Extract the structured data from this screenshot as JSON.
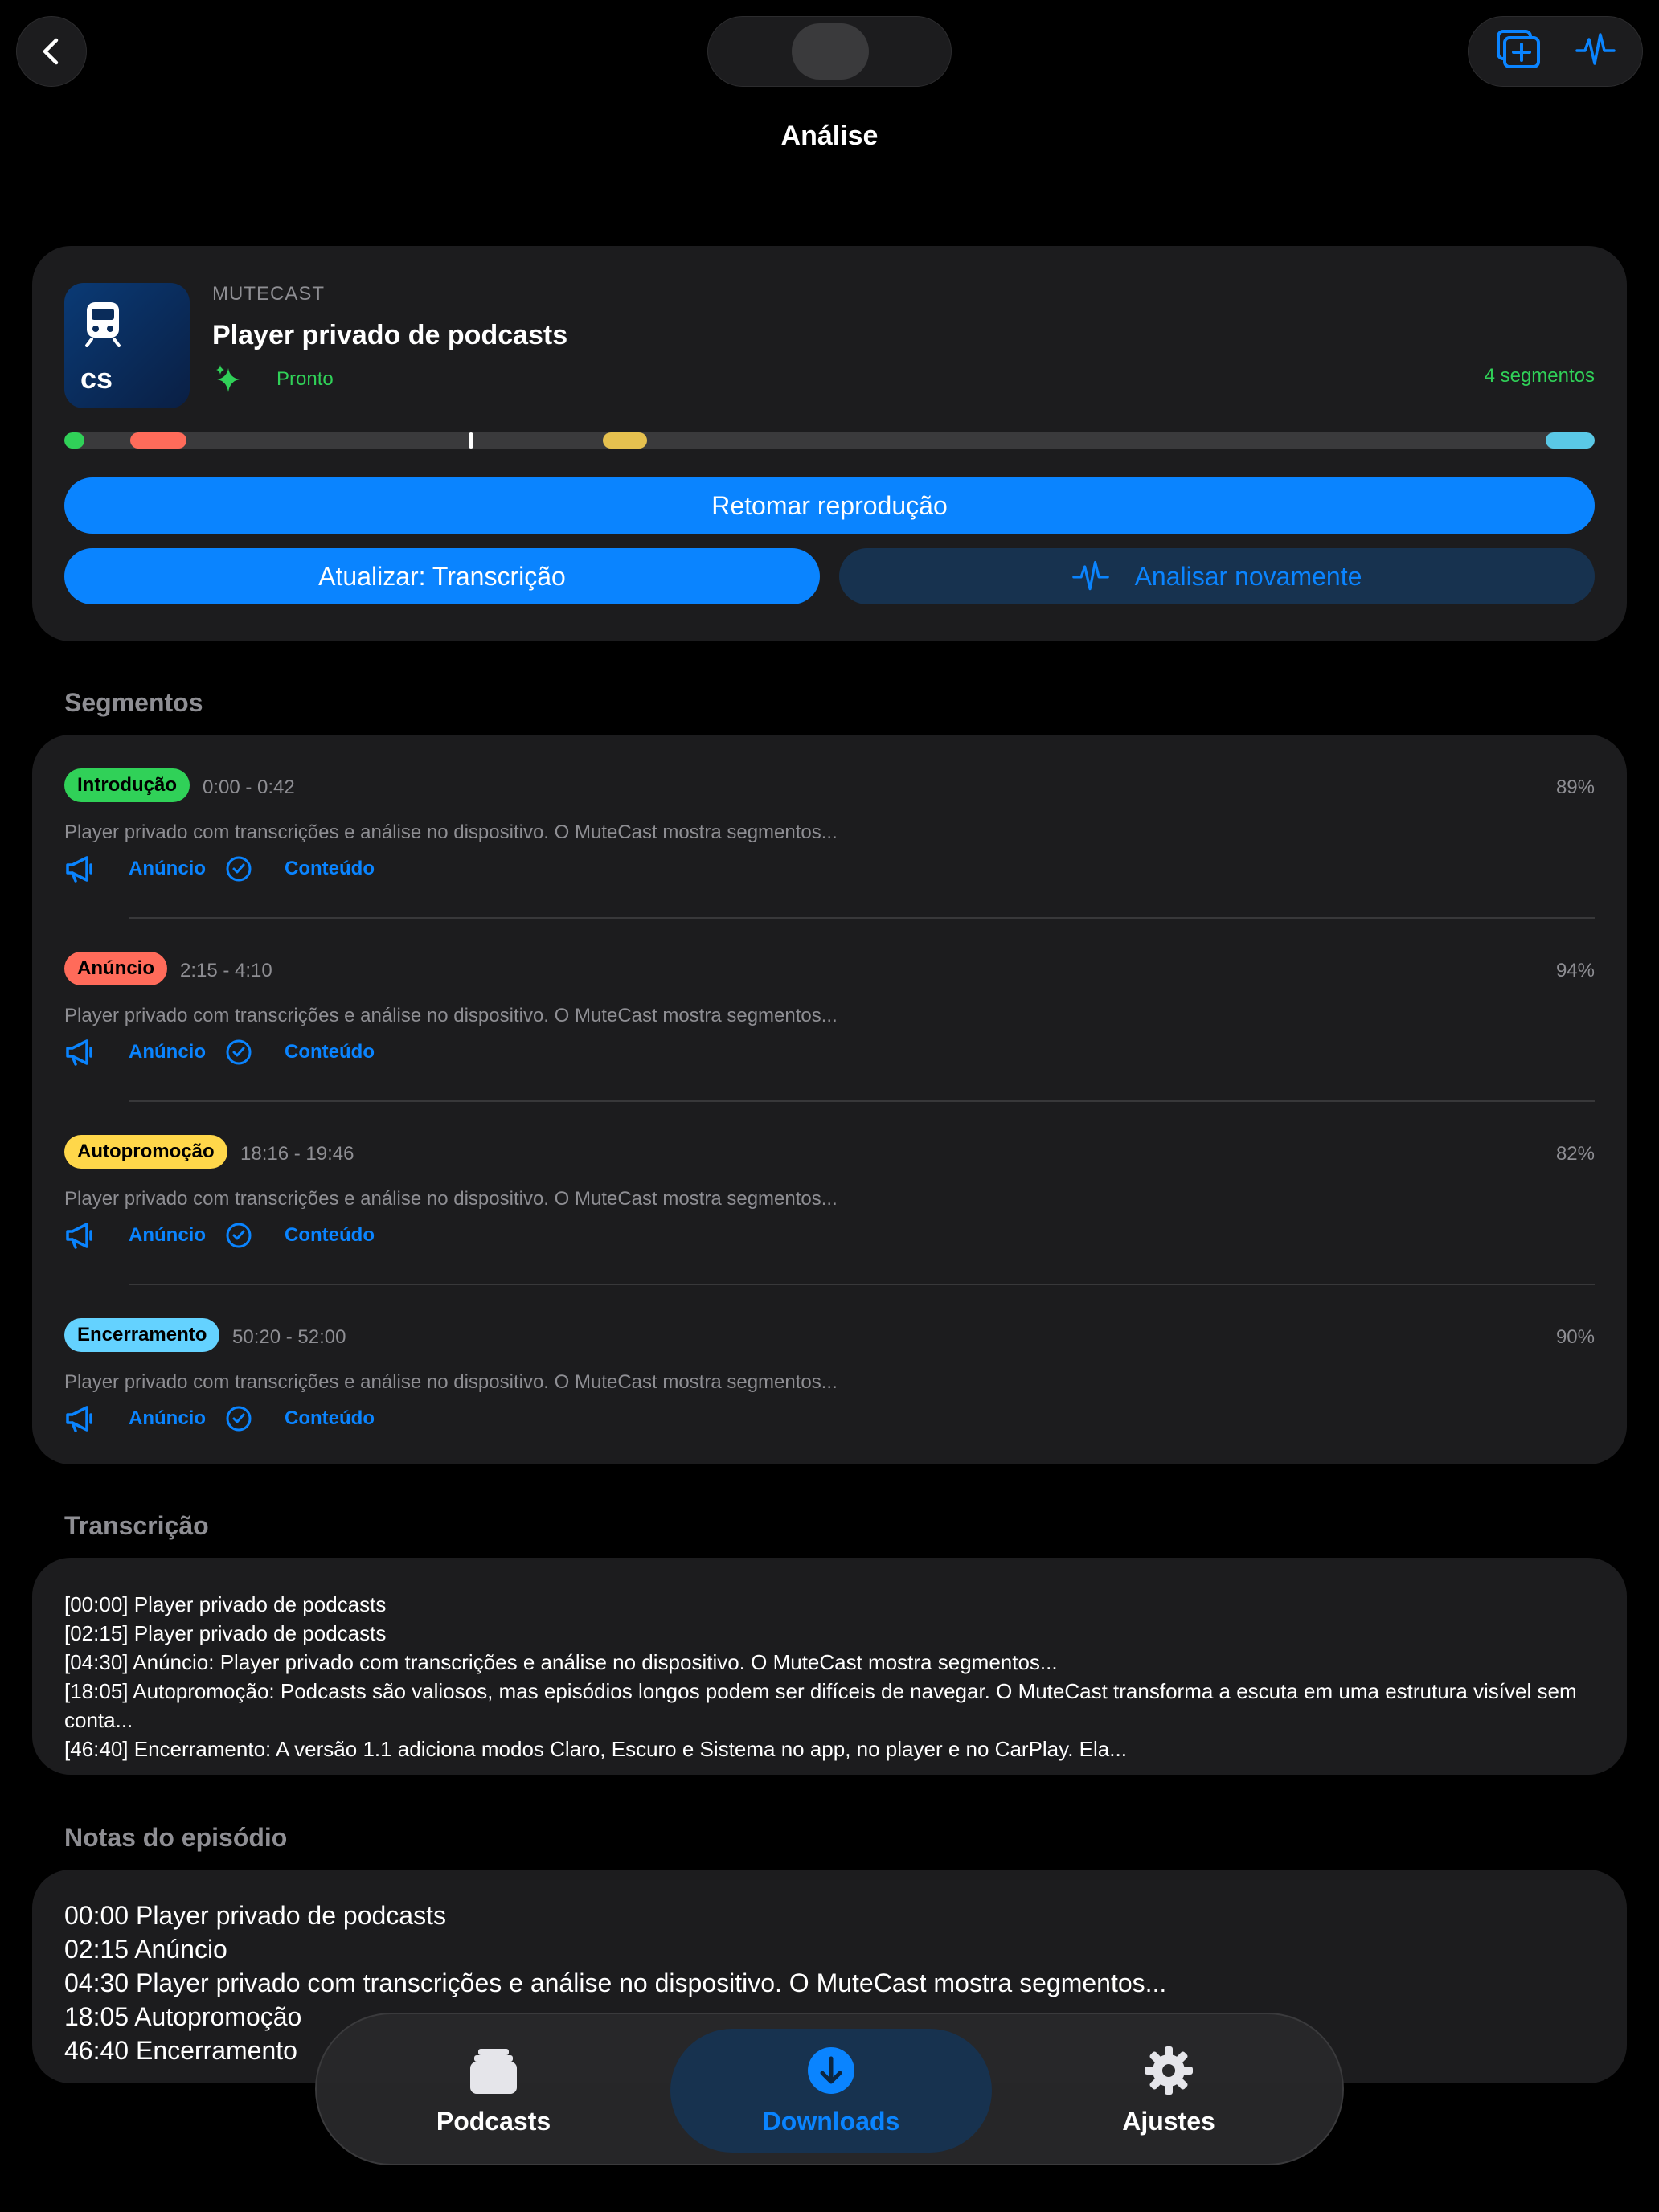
{
  "header": {
    "title": "Análise",
    "back_icon": "chevron-left-icon",
    "actions": [
      "add-to-queue-icon",
      "waveform-icon"
    ]
  },
  "episode": {
    "podcast": "MUTECAST",
    "title": "Player privado de podcasts",
    "artwork_text": "cs",
    "status": "Pronto",
    "segment_count": "4 segmentos"
  },
  "timeline": {
    "segments": [
      {
        "start": 0.0,
        "end": 0.013,
        "color": "#30d158"
      },
      {
        "start": 0.043,
        "end": 0.08,
        "color": "#ff6b5a"
      },
      {
        "start": 0.352,
        "end": 0.381,
        "color": "#e6c14f"
      },
      {
        "start": 0.968,
        "end": 1.0,
        "color": "#5ac8e6"
      }
    ],
    "playhead": 0.264
  },
  "buttons": {
    "resume": "Retomar reprodução",
    "update": "Atualizar: Transcrição",
    "reanalyze": "Analisar novamente"
  },
  "segments_section": {
    "title": "Segmentos",
    "items": [
      {
        "label": "Introdução",
        "color": "#30d158",
        "range": "0:00 - 0:42",
        "confidence": "89%",
        "desc": "Player privado com transcrições e análise no dispositivo. O MuteCast mostra segmentos...",
        "ad_label": "Anúncio",
        "content_label": "Conteúdo"
      },
      {
        "label": "Anúncio",
        "color": "#ff6b5a",
        "range": "2:15 - 4:10",
        "confidence": "94%",
        "desc": "Player privado com transcrições e análise no dispositivo. O MuteCast mostra segmentos...",
        "ad_label": "Anúncio",
        "content_label": "Conteúdo"
      },
      {
        "label": "Autopromoção",
        "color": "#ffd74a",
        "range": "18:16 - 19:46",
        "confidence": "82%",
        "desc": "Player privado com transcrições e análise no dispositivo. O MuteCast mostra segmentos...",
        "ad_label": "Anúncio",
        "content_label": "Conteúdo"
      },
      {
        "label": "Encerramento",
        "color": "#64d2ff",
        "range": "50:20 - 52:00",
        "confidence": "90%",
        "desc": "Player privado com transcrições e análise no dispositivo. O MuteCast mostra segmentos...",
        "ad_label": "Anúncio",
        "content_label": "Conteúdo"
      }
    ]
  },
  "transcript_section": {
    "title": "Transcrição",
    "lines": [
      "[00:00] Player privado de podcasts",
      "[02:15] Player privado de podcasts",
      "[04:30] Anúncio: Player privado com transcrições e análise no dispositivo. O MuteCast mostra segmentos...",
      "[18:05] Autopromoção: Podcasts são valiosos, mas episódios longos podem ser difíceis de navegar. O MuteCast transforma a escuta em uma estrutura visível sem conta...",
      "[46:40] Encerramento: A versão 1.1 adiciona modos Claro, Escuro e Sistema no app, no player e no CarPlay. Ela..."
    ]
  },
  "notes_section": {
    "title": "Notas do episódio",
    "lines": [
      "00:00 Player privado de podcasts",
      "02:15 Anúncio",
      "04:30 Player privado com transcrições e análise no dispositivo. O MuteCast mostra segmentos...",
      "18:05 Autopromoção",
      "46:40 Encerramento"
    ]
  },
  "tabbar": {
    "podcasts": "Podcasts",
    "downloads": "Downloads",
    "settings": "Ajustes",
    "selected": "downloads"
  },
  "colors": {
    "accent": "#0a84ff",
    "ready": "#30d158",
    "card": "#1c1c1e"
  }
}
